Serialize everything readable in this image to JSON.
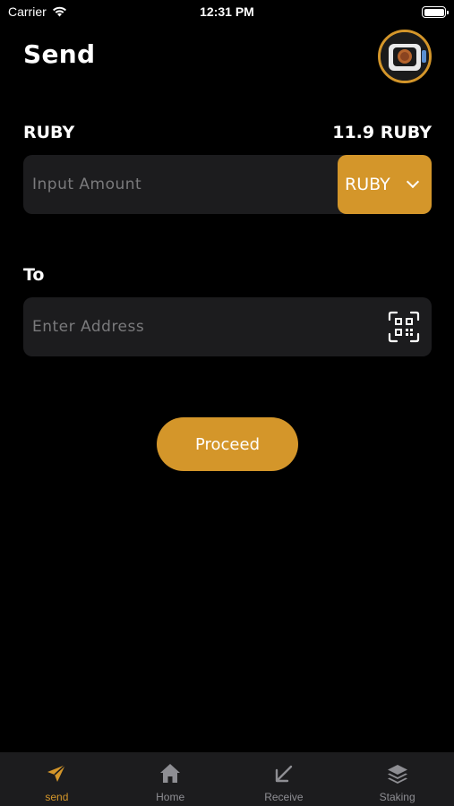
{
  "status_bar": {
    "carrier": "Carrier",
    "time": "12:31 PM"
  },
  "header": {
    "title": "Send"
  },
  "asset": {
    "label": "RUBY",
    "balance": "11.9 RUBY"
  },
  "amount": {
    "placeholder": "Input Amount",
    "value": "",
    "currency": "RUBY"
  },
  "recipient": {
    "label": "To",
    "placeholder": "Enter Address",
    "value": ""
  },
  "actions": {
    "proceed_label": "Proceed"
  },
  "tabs": [
    {
      "label": "send",
      "icon": "send-icon",
      "active": true
    },
    {
      "label": "Home",
      "icon": "home-icon",
      "active": false
    },
    {
      "label": "Receive",
      "icon": "receive-arrow-icon",
      "active": false
    },
    {
      "label": "Staking",
      "icon": "layers-icon",
      "active": false
    }
  ],
  "colors": {
    "accent": "#d4962a",
    "background": "#000000",
    "field": "#1c1c1e",
    "tab_inactive": "#8e8e93"
  }
}
